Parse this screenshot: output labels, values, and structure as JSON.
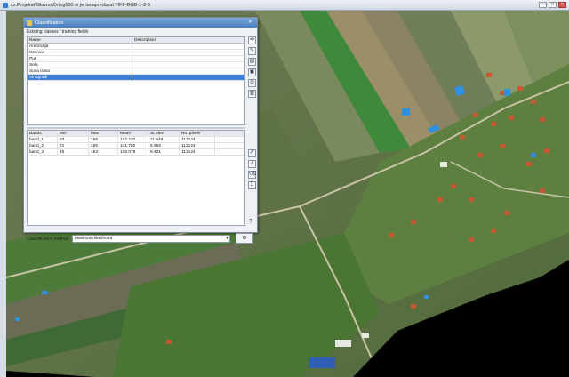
{
  "app": {
    "title": "cs.Projekat\\Glavno\\Ortog500 w jw lanapredizud TIFF-BGB-1-2-3",
    "minimize": "–",
    "maximize": "□",
    "close": "✕"
  },
  "dialog": {
    "title": "Classification",
    "close": "✕",
    "classes_label": "Existing classes / training fields",
    "classes_columns": {
      "name": "Name",
      "description": "Description"
    },
    "classes": [
      {
        "name": "Ambrozija",
        "description": ""
      },
      {
        "name": "Granice",
        "description": ""
      },
      {
        "name": "Put",
        "description": ""
      },
      {
        "name": "Sela",
        "description": ""
      },
      {
        "name": "Suva trava",
        "description": ""
      },
      {
        "name": "Vinogradi",
        "description": ""
      }
    ],
    "selected_class_index": 5,
    "stats_columns": [
      "Bands",
      "Min",
      "Max",
      "Mean",
      "St. dev",
      "No. pixels"
    ],
    "stats_rows": [
      [
        "band_1",
        "53",
        "165",
        "122.227",
        "11.849",
        "112124"
      ],
      [
        "band_2",
        "71",
        "185",
        "141.702",
        "5.956",
        "112124"
      ],
      [
        "band_3",
        "45",
        "153",
        "106.079",
        "9.421",
        "112124"
      ]
    ],
    "method_label": "Classification method",
    "method_value": "Maximum likelihood",
    "help": "?"
  },
  "icons": {
    "class_tools": [
      "add-class-icon",
      "edit-class-icon",
      "open-icon",
      "save-icon",
      "print-icon",
      "delete-icon"
    ],
    "stat_tools": [
      "brush-icon",
      "pointer-icon",
      "clear-icon",
      "sum-icon"
    ]
  },
  "colors": {
    "selection": "#3d7ed6",
    "dialog_title": "#4a7fbf",
    "roof_red": "#c8582f",
    "water_blue": "#2f8fe0",
    "field_green": "#3f8e2f"
  }
}
